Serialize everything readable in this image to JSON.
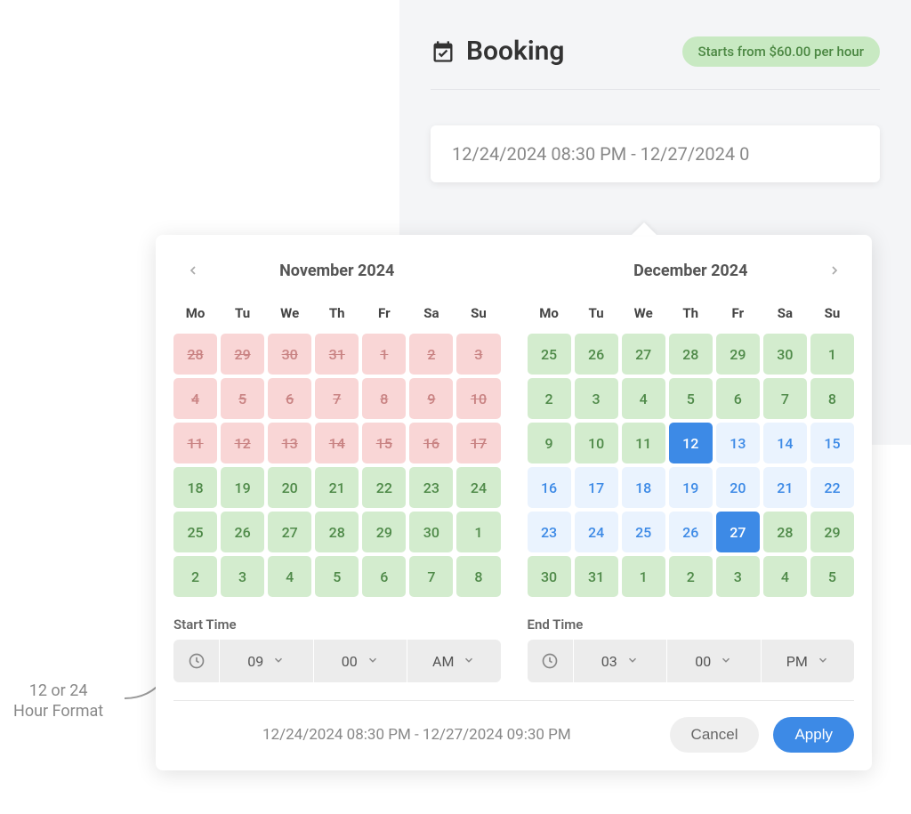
{
  "booking": {
    "title": "Booking",
    "price_badge": "Starts from $60.00 per hour",
    "date_input": "12/24/2024 08:30 PM - 12/27/2024 0"
  },
  "calendar": {
    "dow": [
      "Mo",
      "Tu",
      "We",
      "Th",
      "Fr",
      "Sa",
      "Su"
    ],
    "left": {
      "title": "November 2024",
      "days": [
        {
          "n": "28",
          "s": "unavail"
        },
        {
          "n": "29",
          "s": "unavail"
        },
        {
          "n": "30",
          "s": "unavail"
        },
        {
          "n": "31",
          "s": "unavail"
        },
        {
          "n": "1",
          "s": "unavail"
        },
        {
          "n": "2",
          "s": "unavail"
        },
        {
          "n": "3",
          "s": "unavail"
        },
        {
          "n": "4",
          "s": "unavail"
        },
        {
          "n": "5",
          "s": "unavail"
        },
        {
          "n": "6",
          "s": "unavail"
        },
        {
          "n": "7",
          "s": "unavail"
        },
        {
          "n": "8",
          "s": "unavail"
        },
        {
          "n": "9",
          "s": "unavail"
        },
        {
          "n": "10",
          "s": "unavail"
        },
        {
          "n": "11",
          "s": "unavail"
        },
        {
          "n": "12",
          "s": "unavail"
        },
        {
          "n": "13",
          "s": "unavail"
        },
        {
          "n": "14",
          "s": "unavail"
        },
        {
          "n": "15",
          "s": "unavail"
        },
        {
          "n": "16",
          "s": "unavail"
        },
        {
          "n": "17",
          "s": "unavail"
        },
        {
          "n": "18",
          "s": "avail"
        },
        {
          "n": "19",
          "s": "avail"
        },
        {
          "n": "20",
          "s": "avail"
        },
        {
          "n": "21",
          "s": "avail"
        },
        {
          "n": "22",
          "s": "avail"
        },
        {
          "n": "23",
          "s": "avail"
        },
        {
          "n": "24",
          "s": "avail"
        },
        {
          "n": "25",
          "s": "avail"
        },
        {
          "n": "26",
          "s": "avail"
        },
        {
          "n": "27",
          "s": "avail"
        },
        {
          "n": "28",
          "s": "avail"
        },
        {
          "n": "29",
          "s": "avail"
        },
        {
          "n": "30",
          "s": "avail"
        },
        {
          "n": "1",
          "s": "avail"
        },
        {
          "n": "2",
          "s": "avail"
        },
        {
          "n": "3",
          "s": "avail"
        },
        {
          "n": "4",
          "s": "avail"
        },
        {
          "n": "5",
          "s": "avail"
        },
        {
          "n": "6",
          "s": "avail"
        },
        {
          "n": "7",
          "s": "avail"
        },
        {
          "n": "8",
          "s": "avail"
        }
      ]
    },
    "right": {
      "title": "December 2024",
      "days": [
        {
          "n": "25",
          "s": "avail"
        },
        {
          "n": "26",
          "s": "avail"
        },
        {
          "n": "27",
          "s": "avail"
        },
        {
          "n": "28",
          "s": "avail"
        },
        {
          "n": "29",
          "s": "avail"
        },
        {
          "n": "30",
          "s": "avail"
        },
        {
          "n": "1",
          "s": "avail"
        },
        {
          "n": "2",
          "s": "avail"
        },
        {
          "n": "3",
          "s": "avail"
        },
        {
          "n": "4",
          "s": "avail"
        },
        {
          "n": "5",
          "s": "avail"
        },
        {
          "n": "6",
          "s": "avail"
        },
        {
          "n": "7",
          "s": "avail"
        },
        {
          "n": "8",
          "s": "avail"
        },
        {
          "n": "9",
          "s": "avail"
        },
        {
          "n": "10",
          "s": "avail"
        },
        {
          "n": "11",
          "s": "avail"
        },
        {
          "n": "12",
          "s": "selected"
        },
        {
          "n": "13",
          "s": "range"
        },
        {
          "n": "14",
          "s": "range"
        },
        {
          "n": "15",
          "s": "range"
        },
        {
          "n": "16",
          "s": "range"
        },
        {
          "n": "17",
          "s": "range"
        },
        {
          "n": "18",
          "s": "range"
        },
        {
          "n": "19",
          "s": "range"
        },
        {
          "n": "20",
          "s": "range"
        },
        {
          "n": "21",
          "s": "range"
        },
        {
          "n": "22",
          "s": "range"
        },
        {
          "n": "23",
          "s": "range"
        },
        {
          "n": "24",
          "s": "range"
        },
        {
          "n": "25",
          "s": "range"
        },
        {
          "n": "26",
          "s": "range"
        },
        {
          "n": "27",
          "s": "selected"
        },
        {
          "n": "28",
          "s": "avail"
        },
        {
          "n": "29",
          "s": "avail"
        },
        {
          "n": "30",
          "s": "avail"
        },
        {
          "n": "31",
          "s": "avail"
        },
        {
          "n": "1",
          "s": "avail"
        },
        {
          "n": "2",
          "s": "avail"
        },
        {
          "n": "3",
          "s": "avail"
        },
        {
          "n": "4",
          "s": "avail"
        },
        {
          "n": "5",
          "s": "avail"
        }
      ]
    }
  },
  "times": {
    "start_label": "Start Time",
    "end_label": "End Time",
    "start": {
      "hour": "09",
      "minute": "00",
      "ampm": "AM"
    },
    "end": {
      "hour": "03",
      "minute": "00",
      "ampm": "PM"
    }
  },
  "footer": {
    "summary": "12/24/2024 08:30 PM - 12/27/2024 09:30 PM",
    "cancel": "Cancel",
    "apply": "Apply"
  },
  "annotation": {
    "line1": "12 or 24",
    "line2": "Hour Format"
  }
}
